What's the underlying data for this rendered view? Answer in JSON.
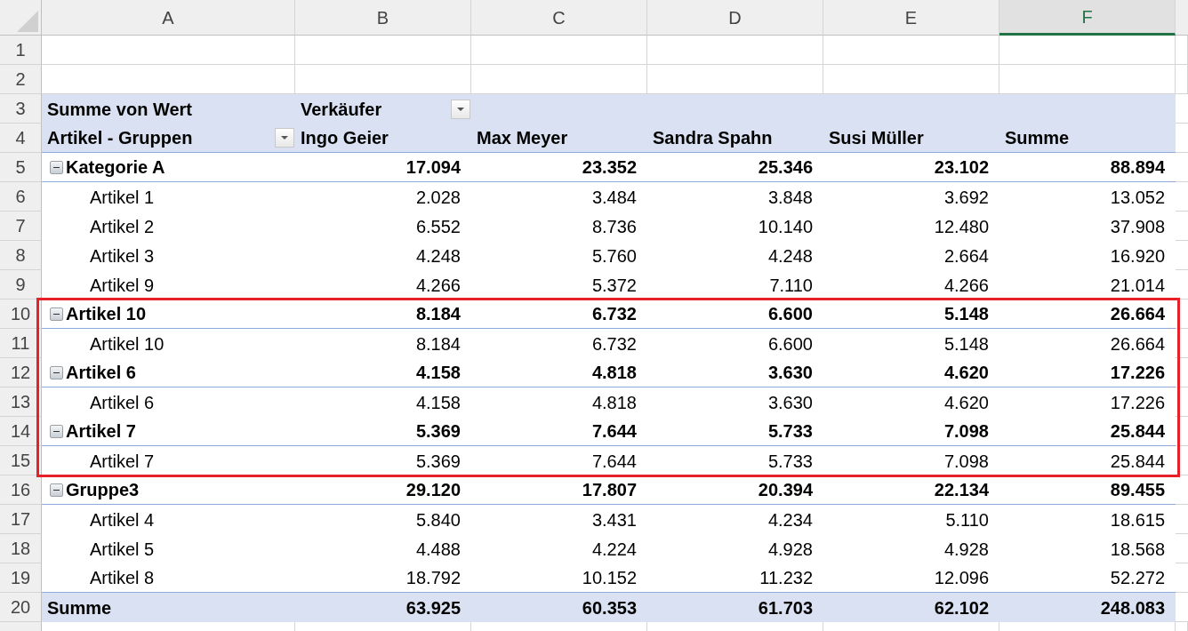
{
  "column_headers": [
    {
      "label": "A",
      "selected": false
    },
    {
      "label": "B",
      "selected": false
    },
    {
      "label": "C",
      "selected": false
    },
    {
      "label": "D",
      "selected": false
    },
    {
      "label": "E",
      "selected": false
    },
    {
      "label": "F",
      "selected": true
    }
  ],
  "row_numbers": [
    "1",
    "2",
    "3",
    "4",
    "5",
    "6",
    "7",
    "8",
    "9",
    "10",
    "11",
    "12",
    "13",
    "14",
    "15",
    "16",
    "17",
    "18",
    "19",
    "20"
  ],
  "pivot": {
    "value_label": "Summe von Wert",
    "column_field": "Verkäufer",
    "row_field": "Artikel - Gruppen",
    "columns": [
      "Ingo Geier",
      "Max Meyer",
      "Sandra Spahn",
      "Susi Müller",
      "Summe"
    ],
    "rows": [
      {
        "kind": "group",
        "label": "Kategorie A",
        "expanded": true,
        "outlined": false,
        "values": [
          "17.094",
          "23.352",
          "25.346",
          "23.102",
          "88.894"
        ]
      },
      {
        "kind": "item",
        "label": "Artikel 1",
        "outlined": false,
        "values": [
          "2.028",
          "3.484",
          "3.848",
          "3.692",
          "13.052"
        ]
      },
      {
        "kind": "item",
        "label": "Artikel 2",
        "outlined": false,
        "values": [
          "6.552",
          "8.736",
          "10.140",
          "12.480",
          "37.908"
        ]
      },
      {
        "kind": "item",
        "label": "Artikel 3",
        "outlined": false,
        "values": [
          "4.248",
          "5.760",
          "4.248",
          "2.664",
          "16.920"
        ]
      },
      {
        "kind": "item",
        "label": "Artikel 9",
        "outlined": false,
        "values": [
          "4.266",
          "5.372",
          "7.110",
          "4.266",
          "21.014"
        ]
      },
      {
        "kind": "group",
        "label": "Artikel 10",
        "expanded": true,
        "outlined": true,
        "values": [
          "8.184",
          "6.732",
          "6.600",
          "5.148",
          "26.664"
        ]
      },
      {
        "kind": "item",
        "label": "Artikel 10",
        "outlined": true,
        "values": [
          "8.184",
          "6.732",
          "6.600",
          "5.148",
          "26.664"
        ]
      },
      {
        "kind": "group",
        "label": "Artikel 6",
        "expanded": true,
        "outlined": true,
        "values": [
          "4.158",
          "4.818",
          "3.630",
          "4.620",
          "17.226"
        ]
      },
      {
        "kind": "item",
        "label": "Artikel 6",
        "outlined": true,
        "values": [
          "4.158",
          "4.818",
          "3.630",
          "4.620",
          "17.226"
        ]
      },
      {
        "kind": "group",
        "label": "Artikel 7",
        "expanded": true,
        "outlined": true,
        "values": [
          "5.369",
          "7.644",
          "5.733",
          "7.098",
          "25.844"
        ]
      },
      {
        "kind": "item",
        "label": "Artikel 7",
        "outlined": true,
        "values": [
          "5.369",
          "7.644",
          "5.733",
          "7.098",
          "25.844"
        ]
      },
      {
        "kind": "group",
        "label": "Gruppe3",
        "expanded": true,
        "outlined": false,
        "values": [
          "29.120",
          "17.807",
          "20.394",
          "22.134",
          "89.455"
        ]
      },
      {
        "kind": "item",
        "label": "Artikel 4",
        "outlined": false,
        "values": [
          "5.840",
          "3.431",
          "4.234",
          "5.110",
          "18.615"
        ]
      },
      {
        "kind": "item",
        "label": "Artikel 5",
        "outlined": false,
        "values": [
          "4.488",
          "4.224",
          "4.928",
          "4.928",
          "18.568"
        ]
      },
      {
        "kind": "item",
        "label": "Artikel 8",
        "outlined": false,
        "values": [
          "18.792",
          "10.152",
          "11.232",
          "12.096",
          "52.272"
        ]
      }
    ],
    "total": {
      "label": "Summe",
      "values": [
        "63.925",
        "60.353",
        "61.703",
        "62.102",
        "248.083"
      ]
    }
  }
}
